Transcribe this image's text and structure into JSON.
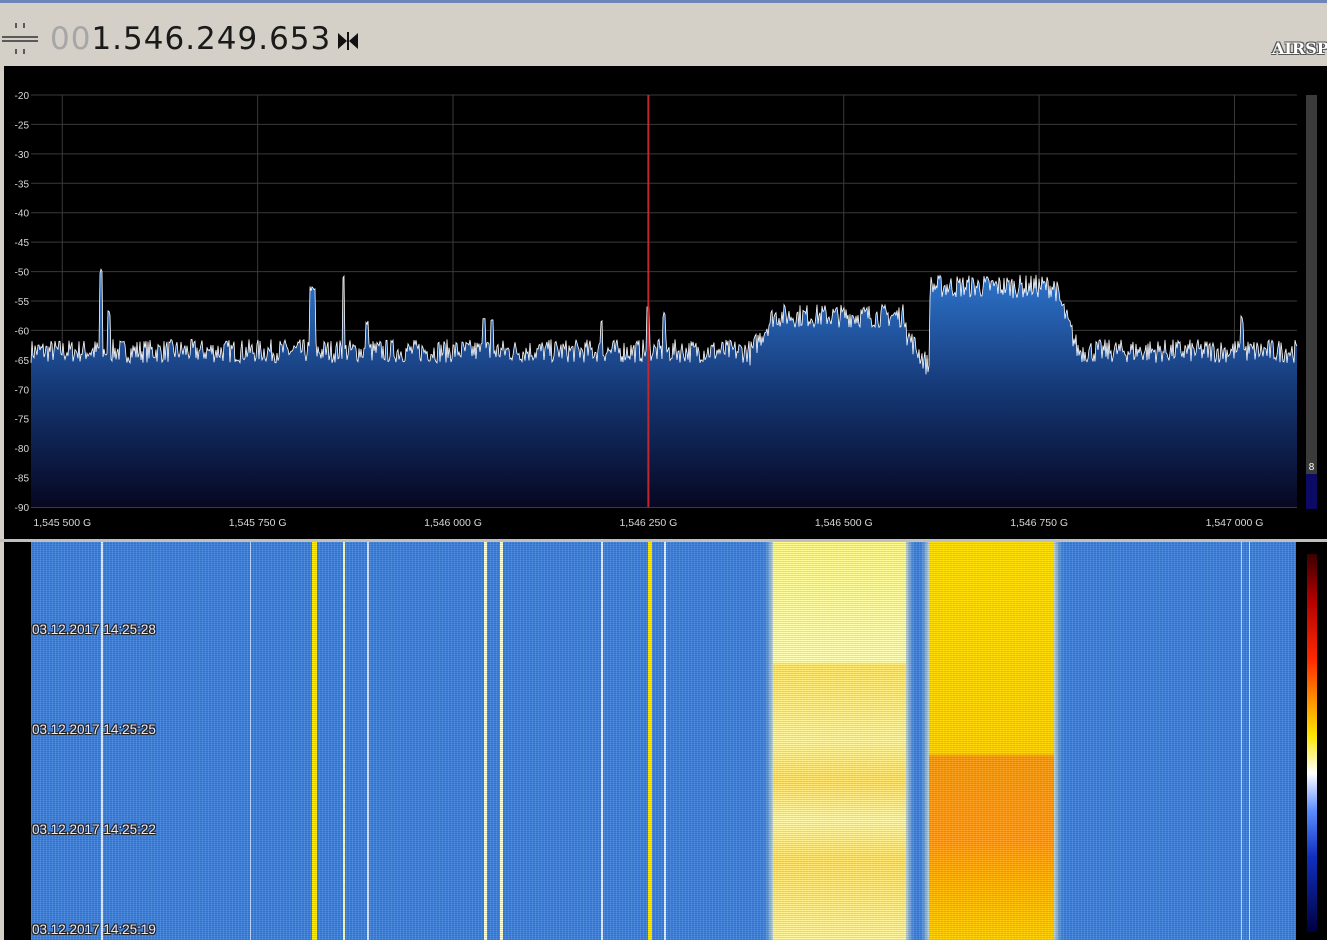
{
  "toolbar": {
    "frequency_dim": "00",
    "frequency_main": "1.546.249.653",
    "logo": "AIRSP"
  },
  "spectrum": {
    "y_ticks": [
      "-20",
      "-25",
      "-30",
      "-35",
      "-40",
      "-45",
      "-50",
      "-55",
      "-60",
      "-65",
      "-70",
      "-75",
      "-80",
      "-85",
      "-90"
    ],
    "x_ticks": [
      "1,545 500 G",
      "1,545 750 G",
      "1,546 000 G",
      "1,546 250 G",
      "1,546 500 G",
      "1,546 750 G",
      "1,547 000 G"
    ],
    "center_marker": "1,546 250 G",
    "side_bar_value": "8",
    "colors": {
      "fill_top": "#2f76cf",
      "fill_bottom": "#070722",
      "trace": "#ffffff",
      "marker": "#c0282e",
      "grid": "#3a3a3a"
    }
  },
  "chart_data": {
    "type": "area",
    "title": "",
    "xlabel": "",
    "ylabel": "",
    "x_unit": "GHz",
    "xlim": [
      1.54546,
      1.54708
    ],
    "ylim": [
      -90,
      -20
    ],
    "grid": true,
    "x": [
      1.54546,
      1.5455,
      1.54553,
      1.54555,
      1.5456,
      1.5457,
      1.5458,
      1.5459,
      1.546,
      1.54601,
      1.54602,
      1.54603,
      1.5461,
      1.5462,
      1.54621,
      1.5463,
      1.54637,
      1.5464,
      1.54645,
      1.5465,
      1.5466,
      1.5467,
      1.54675,
      1.5468,
      1.54685,
      1.5469,
      1.547,
      1.54708
    ],
    "y": [
      -63,
      -64,
      -51,
      -63,
      -64,
      -63,
      -64,
      -57,
      -63,
      -61,
      -58,
      -63,
      -64,
      -65,
      -62,
      -64,
      -64,
      -57,
      -57,
      -58,
      -58,
      -64,
      -53,
      -52,
      -51,
      -63,
      -63,
      -62
    ]
  },
  "waterfall": {
    "timestamps": [
      "03.12.2017 14:25:28",
      "03.12.2017 14:25:25",
      "03.12.2017 14:25:22",
      "03.12.2017 14:25:19"
    ]
  }
}
